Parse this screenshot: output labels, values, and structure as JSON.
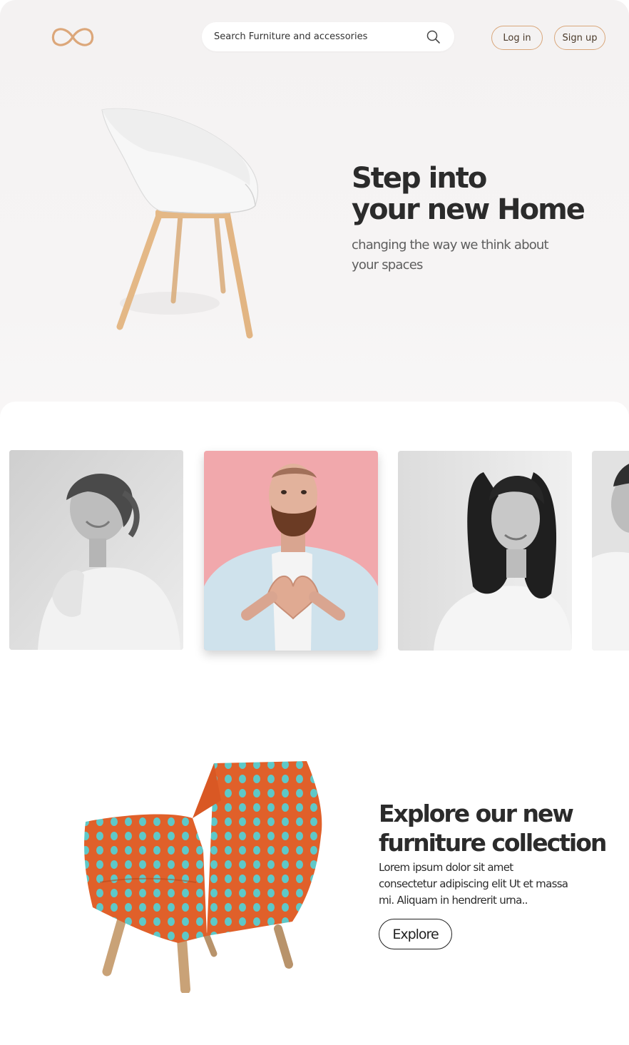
{
  "header": {
    "logo_icon": "infinity-logo-icon",
    "search": {
      "placeholder": "Search Furniture and accessories",
      "value": "",
      "icon": "search-icon"
    },
    "login_label": "Log in",
    "signup_label": "Sign up"
  },
  "hero": {
    "title_line1": "Step into",
    "title_line2": "your new Home",
    "subtitle": "changing the way we think about your spaces",
    "image": "white-chair-image"
  },
  "testimonials": {
    "cards": [
      {
        "image": "laughing-woman-photo",
        "style": "grayscale"
      },
      {
        "image": "man-heart-hands-photo",
        "style": "color"
      },
      {
        "image": "smiling-woman-photo",
        "style": "grayscale"
      },
      {
        "image": "partial-man-photo",
        "style": "grayscale"
      }
    ]
  },
  "promo": {
    "title_line1": "Explore our new",
    "title_line2": "furniture collection",
    "body": "Lorem ipsum dolor sit amet consectetur adipiscing elit Ut et massa mi. Aliquam in hendrerit urna..",
    "button_label": "Explore",
    "image": "orange-polka-dot-armchair-image"
  },
  "colors": {
    "accent": "#d9a77b",
    "hero_bg": "#f5f3f3",
    "text_dark": "#2b2b2b",
    "card_pink": "#f1a8ac",
    "chair_orange": "#e0602a",
    "chair_dots": "#5ec8c8"
  }
}
